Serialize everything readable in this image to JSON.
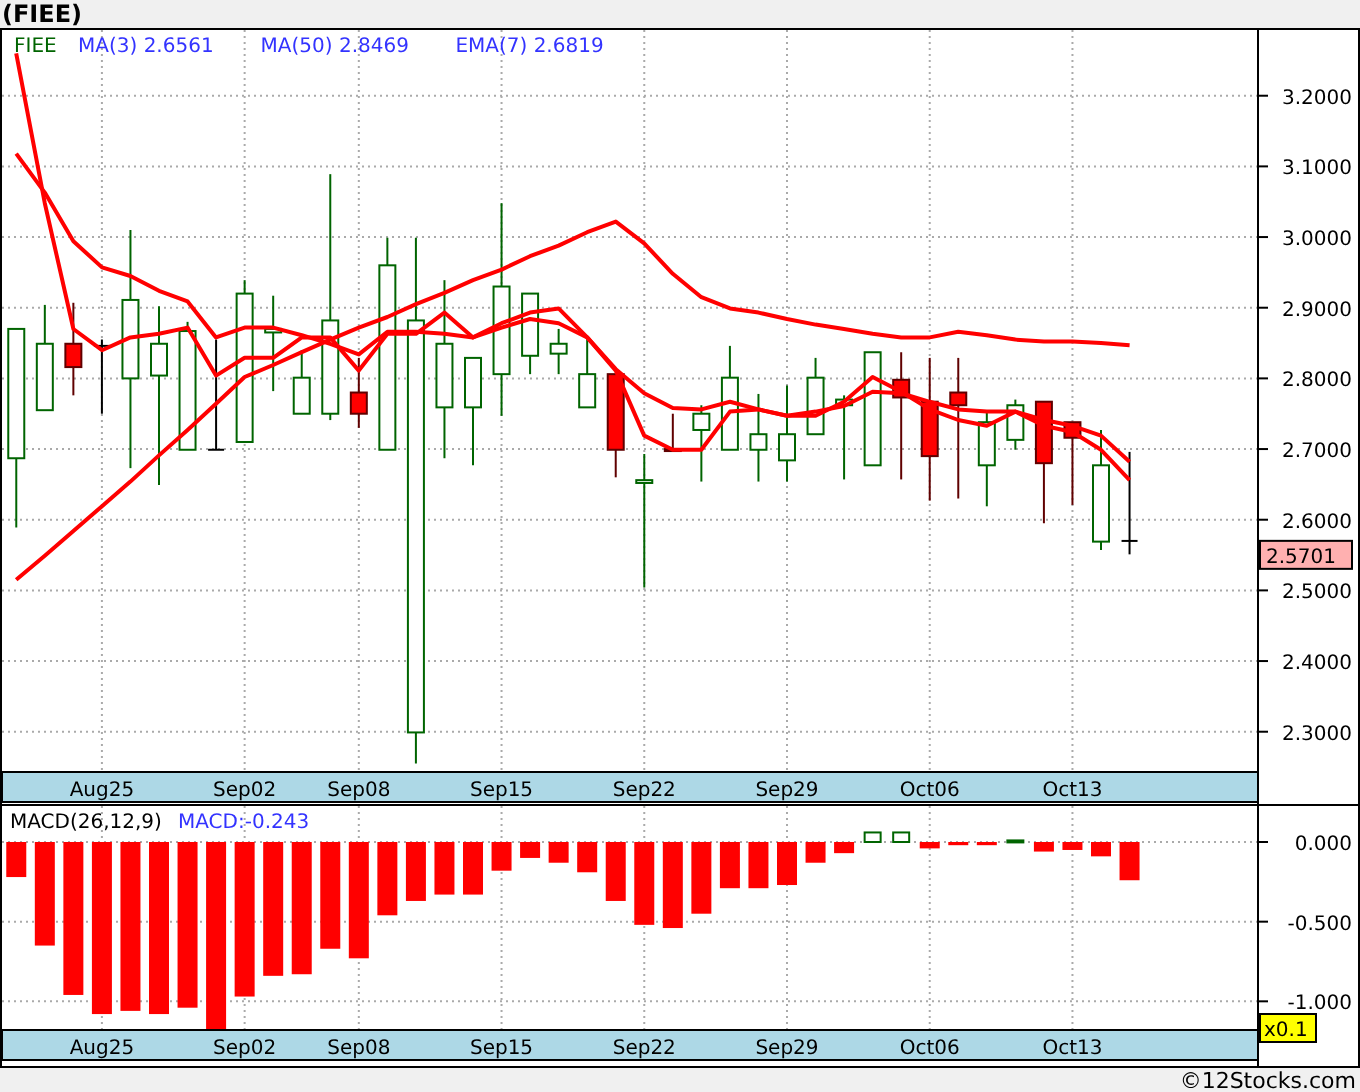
{
  "title": "(FIEE)",
  "price_panel": {
    "ticker": "FIEE",
    "legend_readings": [
      "2.6561",
      "2.8469",
      "2.6819"
    ],
    "last_price": "2.5701",
    "chart_data": {
      "type": "candlestick",
      "grid": true,
      "categories": [
        null,
        null,
        null,
        "Aug25",
        null,
        null,
        null,
        null,
        "Sep02",
        null,
        null,
        null,
        "Sep08",
        null,
        null,
        null,
        null,
        "Sep15",
        null,
        null,
        null,
        null,
        "Sep22",
        null,
        null,
        null,
        null,
        "Sep29",
        null,
        null,
        null,
        null,
        "Oct06",
        null,
        null,
        null,
        null,
        "Oct13",
        null,
        null,
        null,
        null,
        null,
        null
      ],
      "ylim": [
        2.243,
        3.293
      ],
      "yticks": [
        {
          "value": 2.3,
          "label": "2.3000"
        },
        {
          "value": 2.4,
          "label": "2.4000"
        },
        {
          "value": 2.5,
          "label": "2.5000"
        },
        {
          "value": 2.6,
          "label": "2.6000"
        },
        {
          "value": 2.7,
          "label": "2.7000"
        },
        {
          "value": 2.8,
          "label": "2.8000"
        },
        {
          "value": 2.9,
          "label": "2.9000"
        },
        {
          "value": 3.0,
          "label": "3.0000"
        },
        {
          "value": 3.1,
          "label": "3.1000"
        },
        {
          "value": 3.2,
          "label": "3.2000"
        }
      ],
      "ohlc": [
        [
          2.687,
          2.87,
          2.589,
          2.87
        ],
        [
          2.755,
          2.904,
          2.755,
          2.849
        ],
        [
          2.849,
          2.907,
          2.776,
          2.816
        ],
        [
          2.846,
          2.855,
          2.75,
          2.846
        ],
        [
          2.8,
          3.01,
          2.673,
          2.911
        ],
        [
          2.804,
          2.902,
          2.649,
          2.849
        ],
        [
          2.699,
          2.88,
          2.699,
          2.867
        ],
        [
          2.699,
          2.855,
          2.699,
          2.699
        ],
        [
          2.71,
          2.939,
          2.71,
          2.92
        ],
        [
          2.865,
          2.917,
          2.782,
          2.87
        ],
        [
          2.75,
          2.84,
          2.75,
          2.801
        ],
        [
          2.75,
          3.089,
          2.741,
          2.882
        ],
        [
          2.78,
          2.829,
          2.73,
          2.75
        ],
        [
          2.699,
          2.999,
          2.699,
          2.96
        ],
        [
          2.299,
          2.999,
          2.255,
          2.882
        ],
        [
          2.759,
          2.939,
          2.687,
          2.849
        ],
        [
          2.759,
          2.829,
          2.677,
          2.829
        ],
        [
          2.806,
          3.048,
          2.747,
          2.93
        ],
        [
          2.832,
          2.92,
          2.806,
          2.92
        ],
        [
          2.835,
          2.87,
          2.806,
          2.849
        ],
        [
          2.759,
          2.858,
          2.759,
          2.806
        ],
        [
          2.806,
          2.806,
          2.66,
          2.699
        ],
        [
          2.652,
          2.693,
          2.504,
          2.656
        ],
        [
          2.7,
          2.75,
          2.699,
          2.699
        ],
        [
          2.727,
          2.762,
          2.654,
          2.75
        ],
        [
          2.699,
          2.846,
          2.699,
          2.801
        ],
        [
          2.699,
          2.778,
          2.654,
          2.721
        ],
        [
          2.684,
          2.79,
          2.654,
          2.721
        ],
        [
          2.721,
          2.829,
          2.721,
          2.801
        ],
        [
          2.762,
          2.776,
          2.657,
          2.77
        ],
        [
          2.677,
          2.837,
          2.677,
          2.837
        ],
        [
          2.798,
          2.837,
          2.657,
          2.773
        ],
        [
          2.767,
          2.829,
          2.627,
          2.69
        ],
        [
          2.78,
          2.829,
          2.63,
          2.762
        ],
        [
          2.677,
          2.753,
          2.619,
          2.738
        ],
        [
          2.713,
          2.77,
          2.699,
          2.762
        ],
        [
          2.767,
          2.767,
          2.595,
          2.68
        ],
        [
          2.738,
          2.738,
          2.621,
          2.716
        ],
        [
          2.569,
          2.727,
          2.557,
          2.677
        ],
        [
          2.57,
          2.696,
          2.551,
          2.57
        ],
        null,
        null,
        null,
        null
      ],
      "series": [
        {
          "name": "MA(3)",
          "type": "line",
          "color": "#ff0000",
          "values": [
            3.26,
            3.048,
            2.87,
            2.84,
            2.858,
            2.863,
            2.872,
            2.804,
            2.829,
            2.829,
            2.858,
            2.858,
            2.811,
            2.863,
            2.863,
            2.893,
            2.858,
            2.878,
            2.893,
            2.899,
            2.858,
            2.811,
            2.719,
            2.699,
            2.699,
            2.753,
            2.756,
            2.747,
            2.747,
            2.767,
            2.802,
            2.781,
            2.756,
            2.741,
            2.733,
            2.753,
            2.733,
            2.724,
            2.699,
            2.656,
            null,
            null,
            null,
            null
          ]
        },
        {
          "name": "MA(50)",
          "type": "line",
          "color": "#ff0000",
          "values": [
            2.515,
            2.549,
            2.584,
            2.619,
            2.654,
            2.691,
            2.727,
            2.764,
            2.802,
            2.819,
            2.837,
            2.855,
            2.872,
            2.887,
            2.905,
            2.921,
            2.939,
            2.954,
            2.973,
            2.988,
            3.007,
            3.022,
            2.991,
            2.948,
            2.915,
            2.899,
            2.893,
            2.884,
            2.876,
            2.87,
            2.863,
            2.858,
            2.858,
            2.866,
            2.861,
            2.855,
            2.852,
            2.852,
            2.85,
            2.847,
            null,
            null,
            null,
            null
          ]
        },
        {
          "name": "EMA(7)",
          "type": "line",
          "color": "#ff0000",
          "values": [
            3.118,
            3.063,
            2.994,
            2.957,
            2.945,
            2.924,
            2.909,
            2.858,
            2.872,
            2.872,
            2.861,
            2.849,
            2.834,
            2.866,
            2.866,
            2.863,
            2.858,
            2.872,
            2.884,
            2.878,
            2.858,
            2.813,
            2.779,
            2.758,
            2.756,
            2.767,
            2.756,
            2.747,
            2.753,
            2.761,
            2.781,
            2.779,
            2.767,
            2.756,
            2.753,
            2.753,
            2.741,
            2.733,
            2.719,
            2.682,
            null,
            null,
            null,
            null
          ]
        }
      ]
    }
  },
  "macd_panel": {
    "legend": {
      "title": "MACD(26,12,9)",
      "reading": "MACD:-0.243"
    },
    "scale_badge": "x0.1",
    "chart_data": {
      "type": "bar",
      "grid": true,
      "categories": [
        null,
        null,
        null,
        "Aug25",
        null,
        null,
        null,
        null,
        "Sep02",
        null,
        null,
        null,
        "Sep08",
        null,
        null,
        null,
        null,
        "Sep15",
        null,
        null,
        null,
        null,
        "Sep22",
        null,
        null,
        null,
        null,
        "Sep29",
        null,
        null,
        null,
        null,
        "Oct06",
        null,
        null,
        null,
        null,
        "Oct13",
        null,
        null,
        null,
        null,
        null,
        null
      ],
      "ylim": [
        -1.18,
        0.226
      ],
      "yticks": [
        {
          "value": 0,
          "label": "0.000"
        },
        {
          "value": -0.5,
          "label": "-0.500"
        },
        {
          "value": -1,
          "label": "-1.000"
        }
      ],
      "series": [
        {
          "color": "#ff0000",
          "values": [
            -0.22,
            -0.65,
            -0.96,
            -1.08,
            -1.06,
            -1.08,
            -1.04,
            -1.18,
            -0.97,
            -0.84,
            -0.83,
            -0.67,
            -0.73,
            -0.46,
            -0.37,
            -0.33,
            -0.33,
            -0.18,
            -0.1,
            -0.13,
            -0.19,
            -0.37,
            -0.52,
            -0.54,
            -0.45,
            -0.29,
            -0.29,
            -0.27,
            -0.13,
            -0.07,
            null,
            null,
            -0.04,
            -0.02,
            -0.02,
            null,
            -0.06,
            -0.05,
            -0.09,
            -0.24,
            null,
            null,
            null,
            null
          ]
        },
        {
          "color": "#006400",
          "values": [
            null,
            null,
            null,
            null,
            null,
            null,
            null,
            null,
            null,
            null,
            null,
            null,
            null,
            null,
            null,
            null,
            null,
            null,
            null,
            null,
            null,
            null,
            null,
            null,
            null,
            null,
            null,
            null,
            null,
            null,
            0.06,
            0.06,
            null,
            null,
            null,
            0.01,
            null,
            null,
            null,
            null,
            null,
            null,
            null,
            null
          ]
        }
      ]
    }
  },
  "footer": "©12Stocks.com"
}
